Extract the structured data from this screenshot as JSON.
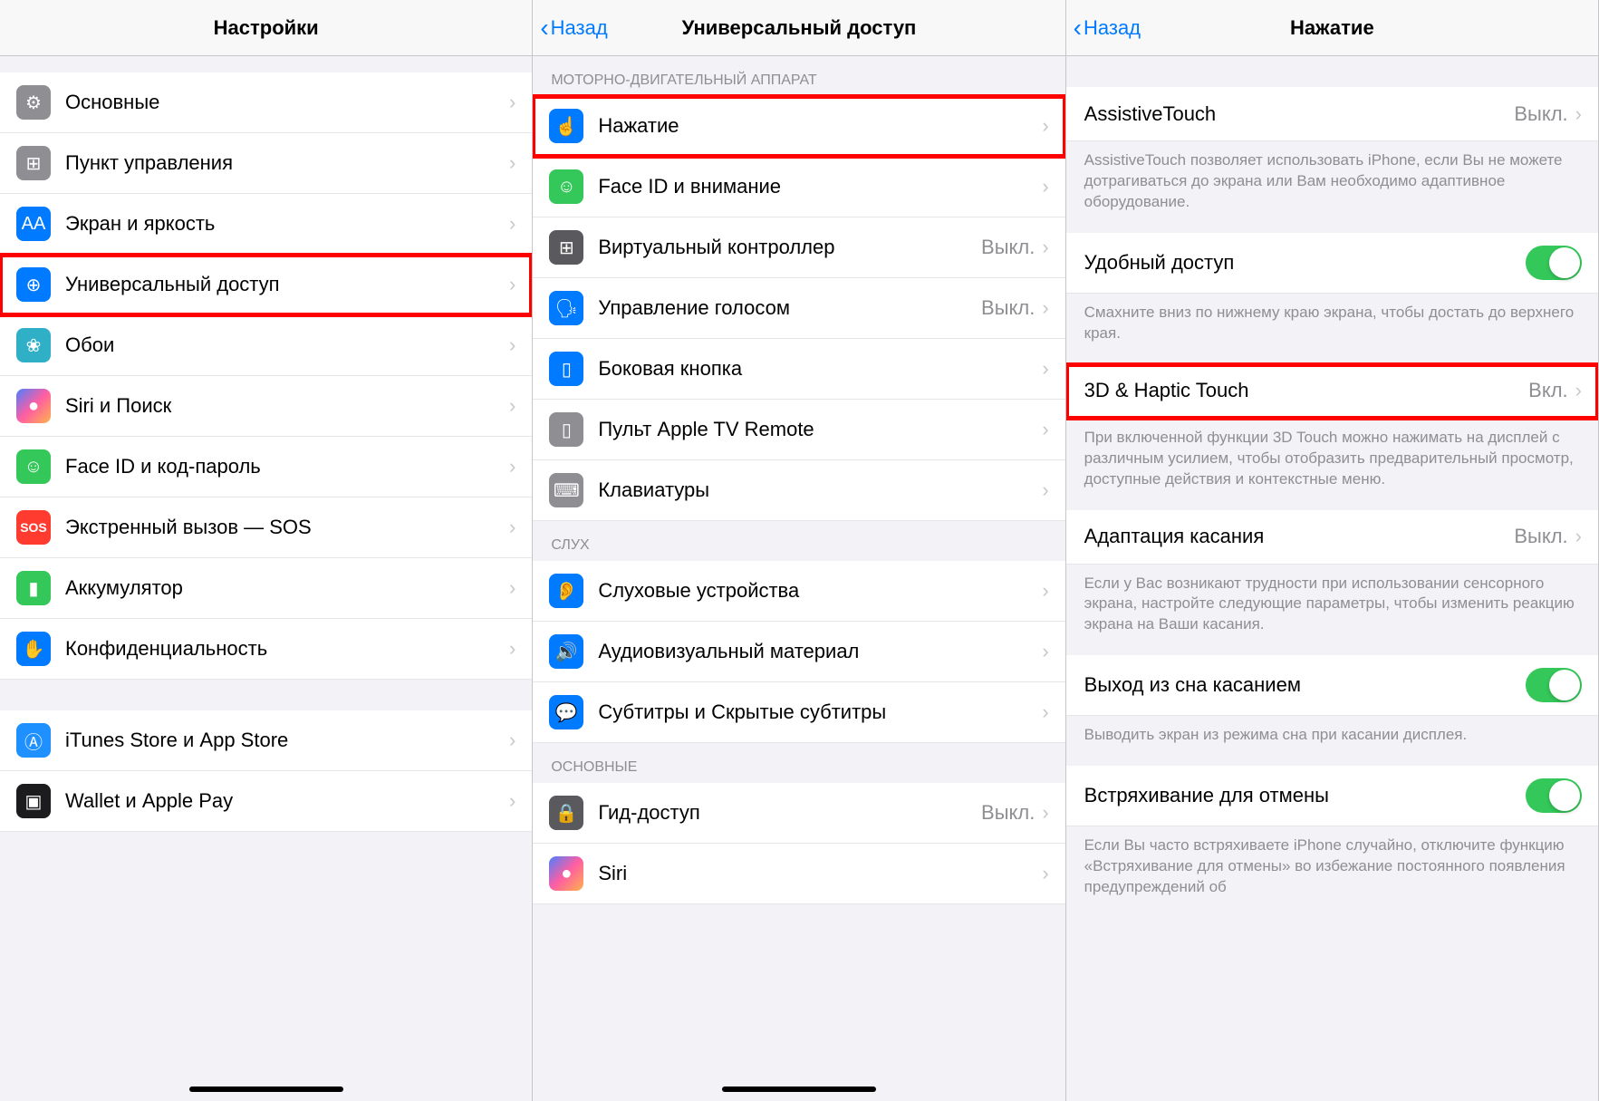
{
  "panel1": {
    "title": "Настройки",
    "rows": [
      {
        "icon": "gear-icon",
        "iconClass": "ic-gray",
        "glyph": "⚙",
        "label": "Основные"
      },
      {
        "icon": "control-center-icon",
        "iconClass": "ic-gray",
        "glyph": "⊞",
        "label": "Пункт управления"
      },
      {
        "icon": "display-icon",
        "iconClass": "ic-blue",
        "glyph": "AA",
        "label": "Экран и яркость"
      },
      {
        "icon": "accessibility-icon",
        "iconClass": "ic-blue",
        "glyph": "⊕",
        "label": "Универсальный доступ",
        "highlight": true
      },
      {
        "icon": "wallpaper-icon",
        "iconClass": "ic-teal",
        "glyph": "❀",
        "label": "Обои"
      },
      {
        "icon": "siri-icon",
        "iconClass": "ic-siri",
        "glyph": "●",
        "label": "Siri и Поиск"
      },
      {
        "icon": "faceid-icon",
        "iconClass": "ic-green",
        "glyph": "☺",
        "label": "Face ID и код-пароль"
      },
      {
        "icon": "sos-icon",
        "iconClass": "ic-sos",
        "glyph": "SOS",
        "label": "Экстренный вызов — SOS"
      },
      {
        "icon": "battery-icon",
        "iconClass": "ic-green",
        "glyph": "▮",
        "label": "Аккумулятор"
      },
      {
        "icon": "privacy-icon",
        "iconClass": "ic-blue",
        "glyph": "✋",
        "label": "Конфиденциальность"
      }
    ],
    "rows2": [
      {
        "icon": "appstore-icon",
        "iconClass": "ic-appstore",
        "glyph": "Ⓐ",
        "label": "iTunes Store и App Store"
      },
      {
        "icon": "wallet-icon",
        "iconClass": "ic-black",
        "glyph": "▣",
        "label": "Wallet и Apple Pay"
      }
    ]
  },
  "panel2": {
    "back": "Назад",
    "title": "Универсальный доступ",
    "section1": "МОТОРНО-ДВИГАТЕЛЬНЫЙ АППАРАТ",
    "rows1": [
      {
        "icon": "touch-icon",
        "iconClass": "ic-blue",
        "glyph": "☝",
        "label": "Нажатие",
        "highlight": true
      },
      {
        "icon": "faceid-attention-icon",
        "iconClass": "ic-green",
        "glyph": "☺",
        "label": "Face ID и внимание"
      },
      {
        "icon": "switch-control-icon",
        "iconClass": "ic-darkgray",
        "glyph": "⊞",
        "label": "Виртуальный контроллер",
        "value": "Выкл."
      },
      {
        "icon": "voice-control-icon",
        "iconClass": "ic-blue",
        "glyph": "🗣",
        "label": "Управление голосом",
        "value": "Выкл."
      },
      {
        "icon": "side-button-icon",
        "iconClass": "ic-blue",
        "glyph": "▯",
        "label": "Боковая кнопка"
      },
      {
        "icon": "tv-remote-icon",
        "iconClass": "ic-gray",
        "glyph": "▯",
        "label": "Пульт Apple TV Remote"
      },
      {
        "icon": "keyboard-icon",
        "iconClass": "ic-gray",
        "glyph": "⌨",
        "label": "Клавиатуры"
      }
    ],
    "section2": "СЛУХ",
    "rows2": [
      {
        "icon": "hearing-icon",
        "iconClass": "ic-blue",
        "glyph": "👂",
        "label": "Слуховые устройства"
      },
      {
        "icon": "audiovisual-icon",
        "iconClass": "ic-blue",
        "glyph": "🔊",
        "label": "Аудиовизуальный материал"
      },
      {
        "icon": "subtitles-icon",
        "iconClass": "ic-blue",
        "glyph": "💬",
        "label": "Субтитры и Скрытые субтитры"
      }
    ],
    "section3": "ОСНОВНЫЕ",
    "rows3": [
      {
        "icon": "guided-access-icon",
        "iconClass": "ic-darkgray",
        "glyph": "🔒",
        "label": "Гид-доступ",
        "value": "Выкл."
      },
      {
        "icon": "siri-icon2",
        "iconClass": "ic-siri",
        "glyph": "●",
        "label": "Siri"
      }
    ]
  },
  "panel3": {
    "back": "Назад",
    "title": "Нажатие",
    "rows": [
      {
        "label": "AssistiveTouch",
        "value": "Выкл.",
        "type": "nav",
        "footer": "AssistiveTouch позволяет использовать iPhone, если Вы не можете дотрагиваться до экрана или Вам необходимо адаптивное оборудование."
      },
      {
        "label": "Удобный доступ",
        "type": "toggle",
        "footer": "Смахните вниз по нижнему краю экрана, чтобы достать до верхнего края."
      },
      {
        "label": "3D & Haptic Touch",
        "value": "Вкл.",
        "type": "nav",
        "highlight": true,
        "footer": "При включенной функции 3D Touch можно нажимать на дисплей с различным усилием, чтобы отобразить предварительный просмотр, доступные действия и контекстные меню."
      },
      {
        "label": "Адаптация касания",
        "value": "Выкл.",
        "type": "nav",
        "footer": "Если у Вас возникают трудности при использовании сенсорного экрана, настройте следующие параметры, чтобы изменить реакцию экрана на Ваши касания."
      },
      {
        "label": "Выход из сна касанием",
        "type": "toggle",
        "footer": "Выводить экран из режима сна при касании дисплея."
      },
      {
        "label": "Встряхивание для отмены",
        "type": "toggle",
        "footer": "Если Вы часто встряхиваете iPhone случайно, отключите функцию «Встряхивание для отмены» во избежание постоянного появления предупреждений об"
      }
    ]
  }
}
